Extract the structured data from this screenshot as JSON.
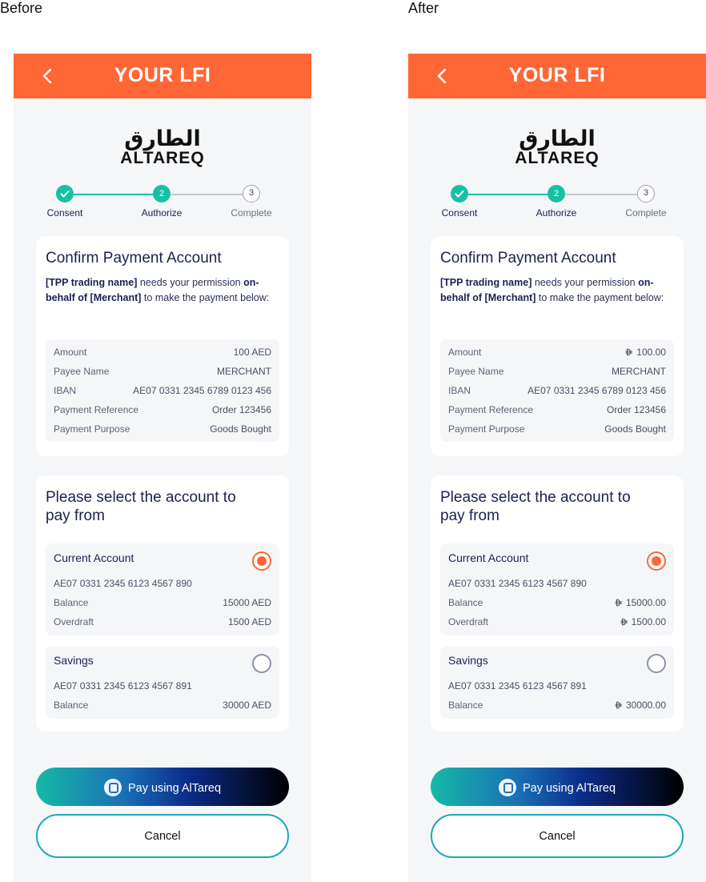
{
  "captions": {
    "before": "Before",
    "after": "After"
  },
  "header": {
    "title": "YOUR LFI"
  },
  "logo": {
    "arabic": "الطارق",
    "latin": "ALTAREQ"
  },
  "steps": [
    {
      "number": "1",
      "label": "Consent",
      "state": "done"
    },
    {
      "number": "2",
      "label": "Authorize",
      "state": "active"
    },
    {
      "number": "3",
      "label": "Complete",
      "state": "todo"
    }
  ],
  "consent": {
    "title": "Confirm Payment Account",
    "tpp": "[TPP trading name]",
    "text1": " needs your permission ",
    "onbehalf": "on-behalf of [Merchant]",
    "text2": " to make the payment below:"
  },
  "payment_labels": {
    "amount": "Amount",
    "payee": "Payee Name",
    "iban": "IBAN",
    "reference": "Payment Reference",
    "purpose": "Payment Purpose"
  },
  "payment": {
    "payee": "MERCHANT",
    "iban": "AE07 0331 2345 6789 0123 456",
    "reference": "Order 123456",
    "purpose": "Goods Bought"
  },
  "select": {
    "title_line1": "Please select the account to",
    "title_line2": "pay from"
  },
  "account_labels": {
    "balance": "Balance",
    "overdraft": "Overdraft"
  },
  "accounts": [
    {
      "name": "Current Account",
      "iban": "AE07 0331 2345 6123 4567 890",
      "selected": true
    },
    {
      "name": "Savings",
      "iban": "AE07 0331 2345 6123 4567 891",
      "selected": false
    }
  ],
  "before": {
    "amount": "100 AED",
    "current_balance": "15000 AED",
    "current_overdraft": "1500 AED",
    "savings_balance": "30000 AED"
  },
  "after": {
    "amount": "100.00",
    "current_balance": "15000.00",
    "current_overdraft": "1500.00",
    "savings_balance": "30000.00"
  },
  "actions": {
    "pay": "Pay using AlTareq",
    "cancel": "Cancel"
  },
  "colors": {
    "brand": "#ff6636",
    "accent": "#16c1a3",
    "text": "#1b2150",
    "background": "#f5f6f8"
  }
}
